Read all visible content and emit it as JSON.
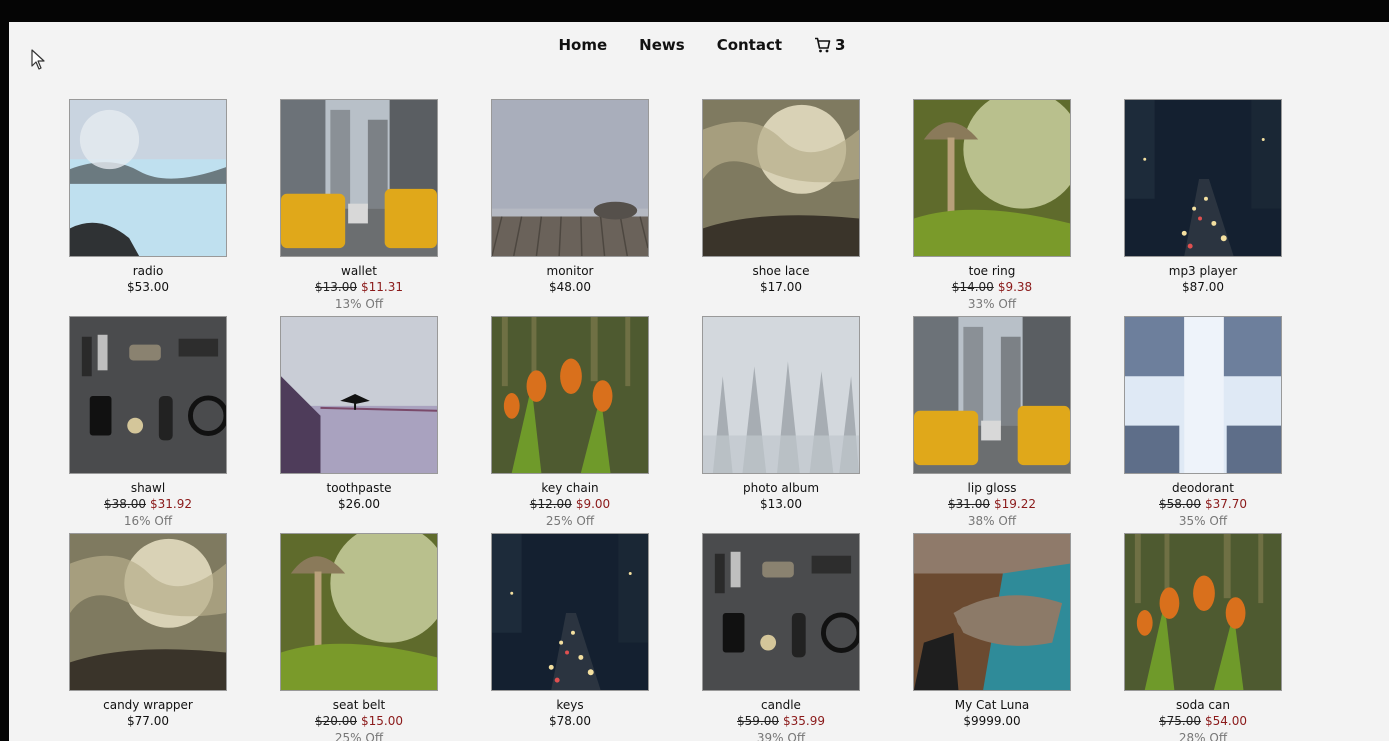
{
  "nav": {
    "home": "Home",
    "news": "News",
    "contact": "Contact",
    "cart_count": "3"
  },
  "products": [
    {
      "name": "radio",
      "price": "$53.00",
      "scene": "lagoon"
    },
    {
      "name": "wallet",
      "old_price": "$13.00",
      "price": "$11.31",
      "discount": "13% Off",
      "scene": "city"
    },
    {
      "name": "monitor",
      "price": "$48.00",
      "scene": "pier"
    },
    {
      "name": "shoe lace",
      "price": "$17.00",
      "scene": "sunset"
    },
    {
      "name": "toe ring",
      "old_price": "$14.00",
      "price": "$9.38",
      "discount": "33% Off",
      "scene": "mushroom"
    },
    {
      "name": "mp3 player",
      "price": "$87.00",
      "scene": "night"
    },
    {
      "name": "shawl",
      "old_price": "$38.00",
      "price": "$31.92",
      "discount": "16% Off",
      "scene": "flatlay"
    },
    {
      "name": "toothpaste",
      "price": "$26.00",
      "scene": "bird"
    },
    {
      "name": "key chain",
      "old_price": "$12.00",
      "price": "$9.00",
      "discount": "25% Off",
      "scene": "tulips"
    },
    {
      "name": "photo album",
      "price": "$13.00",
      "scene": "snow"
    },
    {
      "name": "lip gloss",
      "old_price": "$31.00",
      "price": "$19.22",
      "discount": "38% Off",
      "scene": "city"
    },
    {
      "name": "deodorant",
      "old_price": "$58.00",
      "price": "$37.70",
      "discount": "35% Off",
      "scene": "sky"
    },
    {
      "name": "candy wrapper",
      "price": "$77.00",
      "scene": "sunset"
    },
    {
      "name": "seat belt",
      "old_price": "$20.00",
      "price": "$15.00",
      "discount": "25% Off",
      "scene": "mushroom"
    },
    {
      "name": "keys",
      "price": "$78.00",
      "scene": "night"
    },
    {
      "name": "candle",
      "old_price": "$59.00",
      "price": "$35.99",
      "discount": "39% Off",
      "scene": "flatlay"
    },
    {
      "name": "My Cat Luna",
      "price": "$9999.00",
      "scene": "cat"
    },
    {
      "name": "soda can",
      "old_price": "$75.00",
      "price": "$54.00",
      "discount": "28% Off",
      "scene": "tulips"
    }
  ]
}
